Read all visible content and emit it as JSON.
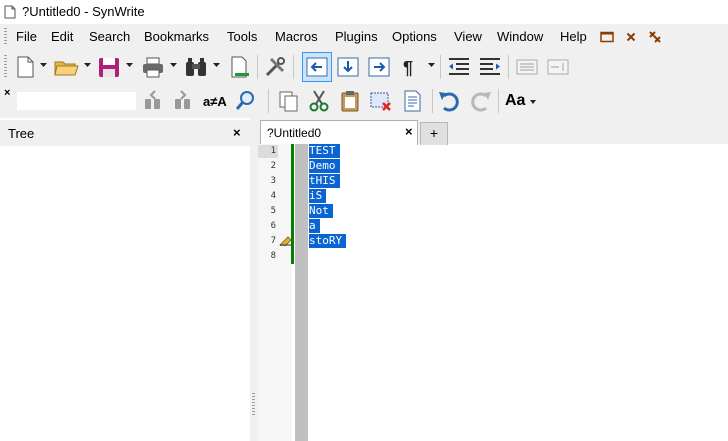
{
  "window": {
    "title": "?Untitled0 - SynWrite"
  },
  "menu": [
    "File",
    "Edit",
    "Search",
    "Bookmarks",
    "Tools",
    "Macros",
    "Plugins",
    "Options",
    "View",
    "Window",
    "Help"
  ],
  "menu_icons": [
    "window-restore-icon",
    "close-icon",
    "pin-icon"
  ],
  "toolbar1": [
    "new-file-icon",
    "open-folder-icon",
    "save-icon",
    "print-icon",
    "find-binoculars-icon",
    "goto-icon",
    "tools-icon",
    "indent-left-icon",
    "indent-down-icon",
    "indent-right-icon",
    "paragraph-icon",
    "align-left-icon",
    "align-right-icon",
    "collapse-icon",
    "expand-icon"
  ],
  "toolbar2": [
    "close-search-icon",
    "search-input",
    "find-prev-icon",
    "find-next-icon",
    "replace-icon",
    "zoom-icon",
    "copy-icon",
    "cut-icon",
    "paste-icon",
    "delete-selection-icon",
    "document-icon",
    "undo-icon",
    "redo-icon",
    "font-size-icon"
  ],
  "replace_label": "a≠A",
  "font_label": "Aa",
  "tree": {
    "title": "Tree",
    "close": "×"
  },
  "tabs": [
    {
      "label": "?Untitled0",
      "close": "×"
    }
  ],
  "new_tab": "+",
  "editor": {
    "lines": [
      "TEST",
      "Demo",
      "tHIS",
      "iS",
      "Not",
      "a",
      "stoRY",
      ""
    ],
    "line_numbers": [
      "1",
      "2",
      "3",
      "4",
      "5",
      "6",
      "7",
      "8"
    ],
    "selection_color": "#0a64d2"
  },
  "colors": {
    "accent": "#0a64d2",
    "change_bar": "#008000",
    "chrome": "#f0f0f0"
  }
}
